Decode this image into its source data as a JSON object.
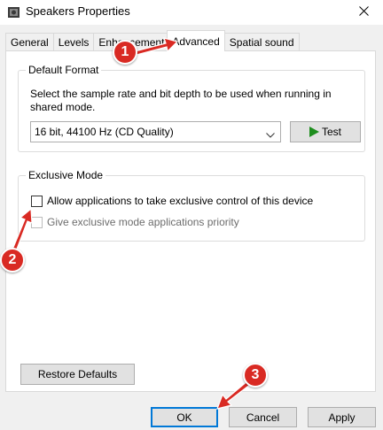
{
  "window": {
    "title": "Speakers Properties"
  },
  "tabs": [
    {
      "label": "General",
      "active": false
    },
    {
      "label": "Levels",
      "active": false
    },
    {
      "label": "Enhancements",
      "active": false
    },
    {
      "label": "Advanced",
      "active": true
    },
    {
      "label": "Spatial sound",
      "active": false
    }
  ],
  "default_format": {
    "legend": "Default Format",
    "description": "Select the sample rate and bit depth to be used when running in shared mode.",
    "selected_format": "16 bit, 44100 Hz (CD Quality)",
    "test_label": "Test"
  },
  "exclusive_mode": {
    "legend": "Exclusive Mode",
    "allow_label": "Allow applications to take exclusive control of this device",
    "allow_checked": false,
    "priority_label": "Give exclusive mode applications priority",
    "priority_checked": false,
    "priority_enabled": false
  },
  "actions": {
    "restore_defaults": "Restore Defaults",
    "ok": "OK",
    "cancel": "Cancel",
    "apply": "Apply"
  },
  "annotations": {
    "step1": "1",
    "step2": "2",
    "step3": "3",
    "color": "#d92a23"
  }
}
